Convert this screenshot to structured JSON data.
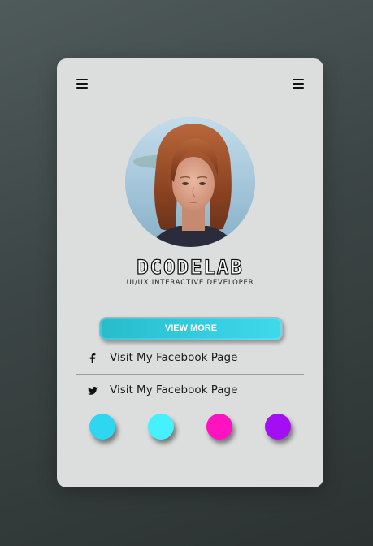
{
  "profile": {
    "name": "DCODELAB",
    "role": "UI/UX INTERACTIVE DEVELOPER",
    "avatar_alt": "profile photo"
  },
  "actions": {
    "view_more_label": "VIEW MORE"
  },
  "links": [
    {
      "icon": "facebook-icon",
      "label": "Visit My Facebook Page"
    },
    {
      "icon": "twitter-icon",
      "label": "Visit My Facebook Page"
    }
  ],
  "theme_swatches": [
    {
      "name": "cyan",
      "color": "#2fd6ef"
    },
    {
      "name": "aqua",
      "color": "#45f0ff"
    },
    {
      "name": "magenta",
      "color": "#ff12c0"
    },
    {
      "name": "purple",
      "color": "#a20ff2"
    }
  ],
  "colors": {
    "accent": "#2fcbdc",
    "card_background": "#dcdddd"
  }
}
